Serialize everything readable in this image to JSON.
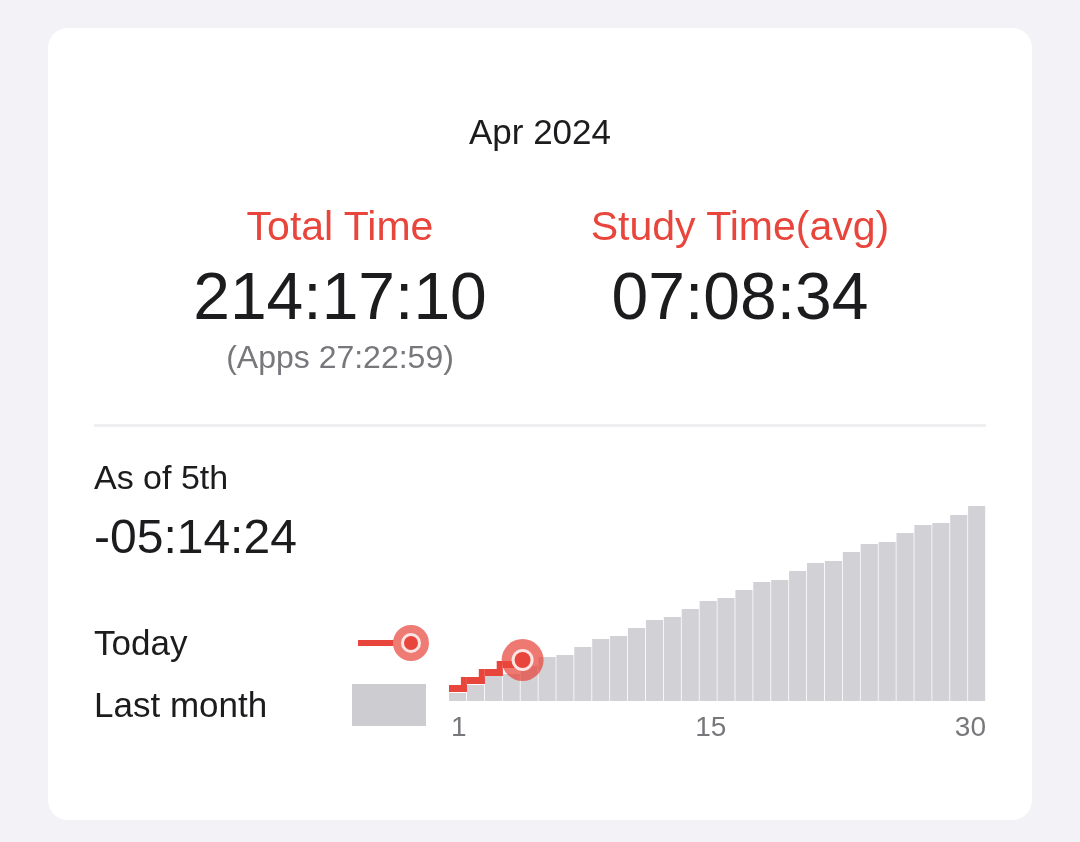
{
  "month": "Apr 2024",
  "stats": [
    {
      "label": "Total Time",
      "value": "214:17:10",
      "note": "(Apps 27:22:59)"
    },
    {
      "label": "Study Time(avg)",
      "value": "07:08:34"
    }
  ],
  "as_of": {
    "label": "As of 5th",
    "value": "-05:14:24"
  },
  "legend": [
    {
      "label": "Today",
      "kind": "line"
    },
    {
      "label": "Last month",
      "kind": "swatch"
    }
  ],
  "x_ticks": [
    "1",
    "15",
    "30"
  ]
}
